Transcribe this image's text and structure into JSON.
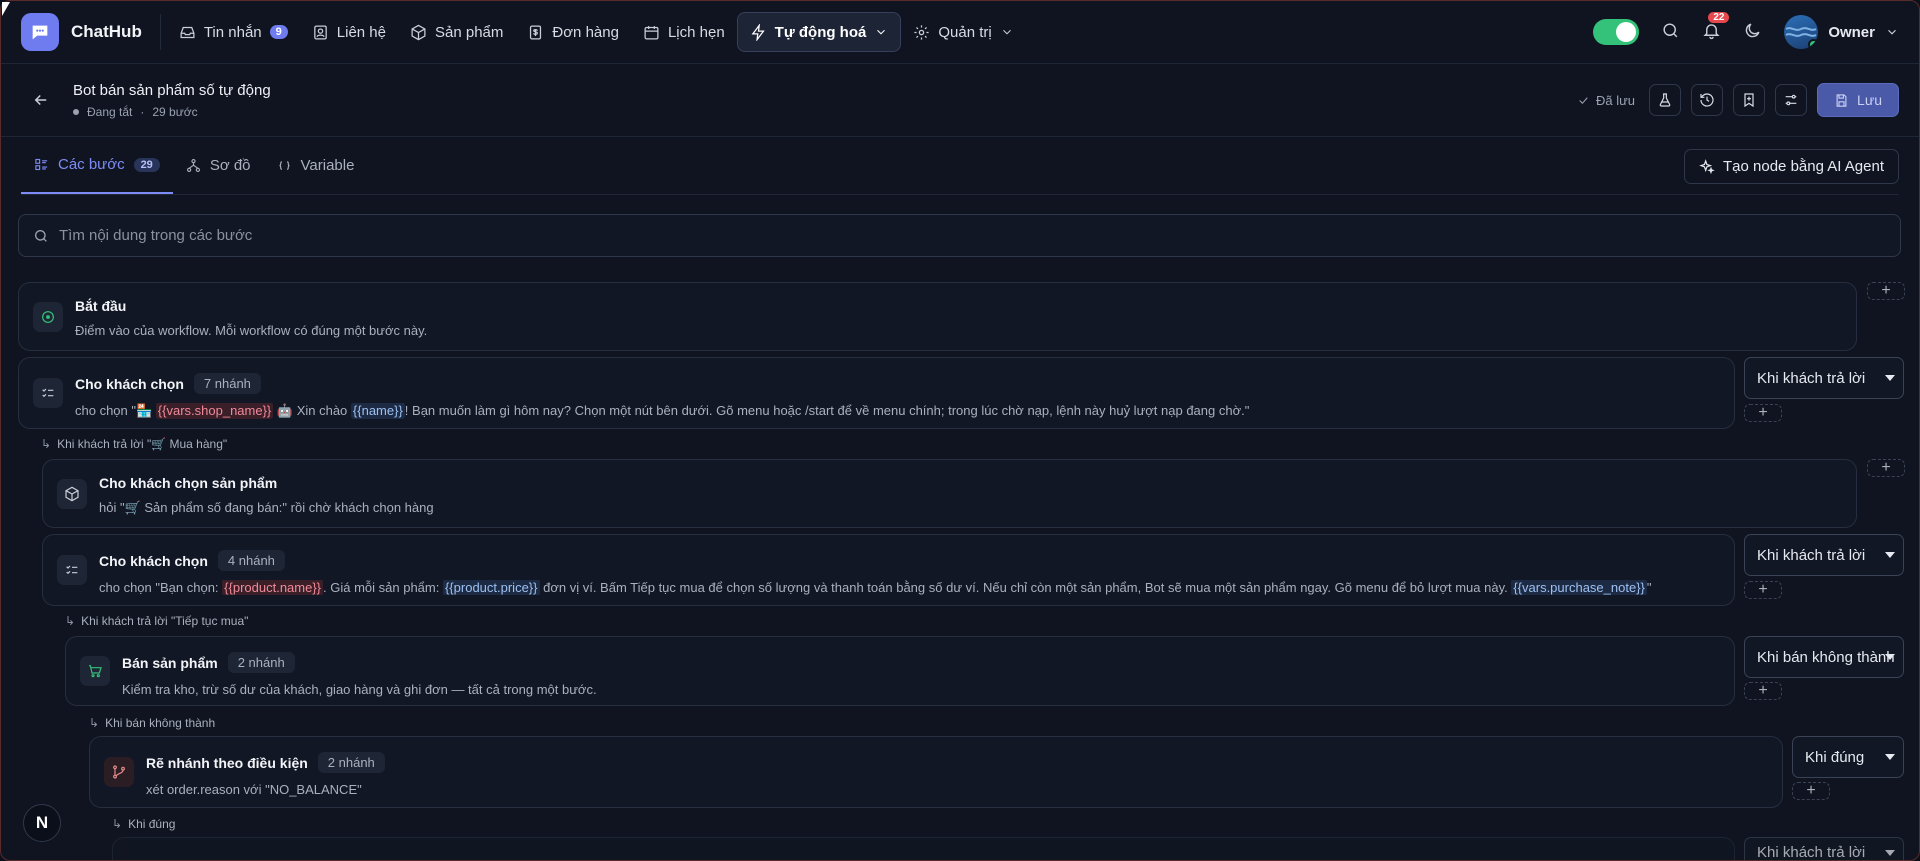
{
  "nav": {
    "brand": "ChatHub",
    "items": [
      {
        "label": "Tin nhắn",
        "badge": "9",
        "icon": "inbox-icon"
      },
      {
        "label": "Liên hệ",
        "icon": "contact-icon"
      },
      {
        "label": "Sản phẩm",
        "icon": "box-icon"
      },
      {
        "label": "Đơn hàng",
        "icon": "receipt-icon"
      },
      {
        "label": "Lịch hẹn",
        "icon": "calendar-icon"
      },
      {
        "label": "Tự động hoá",
        "icon": "bolt-icon",
        "active": true
      },
      {
        "label": "Quản trị",
        "icon": "gear-icon"
      }
    ],
    "notifications": "22",
    "user": "Owner"
  },
  "workflow": {
    "title": "Bot bán sản phẩm số tự động",
    "status": "Đang tắt",
    "steps_count": "29 bước",
    "saved": "Đã lưu",
    "save_label": "Lưu"
  },
  "tabs": [
    {
      "label": "Các bước",
      "count": "29",
      "active": true
    },
    {
      "label": "Sơ đồ"
    },
    {
      "label": "Variable"
    }
  ],
  "ai_button": "Tạo node bằng AI Agent",
  "search": {
    "placeholder": "Tìm nội dung trong các bước"
  },
  "steps": {
    "s1": {
      "title": "Bắt đầu",
      "desc": "Điểm vào của workflow. Mỗi workflow có đúng một bước này."
    },
    "s2": {
      "title": "Cho khách chọn",
      "pill": "7 nhánh",
      "desc_a": "cho chọn \"🏪 ",
      "var1": "{{vars.shop_name}}",
      "desc_b": " 🤖 Xin chào ",
      "var2": "{{name}}",
      "desc_c": "! Bạn muốn làm gì hôm nay? Chọn một nút bên dưới. Gõ menu hoặc /start để về menu chính; trong lúc chờ nạp, lệnh này huỷ lượt nạp đang chờ.\"",
      "branch": "Khi khách trả lời"
    },
    "b2": "Khi khách trả lời \"🛒 Mua hàng\"",
    "s3": {
      "title": "Cho khách chọn sản phẩm",
      "desc": "hỏi \"🛒 Sản phẩm số đang bán:\" rồi chờ khách chọn hàng"
    },
    "s4": {
      "title": "Cho khách chọn",
      "pill": "4 nhánh",
      "desc_a": "cho chọn \"Bạn chọn: ",
      "var1": "{{product.name}}",
      "desc_b": ". Giá mỗi sản phẩm: ",
      "var2": "{{product.price}}",
      "desc_c": " đơn vị ví. Bấm Tiếp tục mua để chọn số lượng và thanh toán bằng số dư ví. Nếu chỉ còn một sản phẩm, Bot sẽ mua một sản phẩm ngay. Gõ menu để bỏ lượt mua này. ",
      "var3": "{{vars.purchase_note}}",
      "desc_d": "\"",
      "branch": "Khi khách trả lời"
    },
    "b4": "Khi khách trả lời \"Tiếp tục mua\"",
    "s5": {
      "title": "Bán sản phẩm",
      "pill": "2 nhánh",
      "desc": "Kiểm tra kho, trừ số dư của khách, giao hàng và ghi đơn — tất cả trong một bước.",
      "branch": "Khi bán không thành"
    },
    "b5": "Khi bán không thành",
    "s6": {
      "title": "Rẽ nhánh theo điều kiện",
      "pill": "2 nhánh",
      "desc": "xét order.reason với \"NO_BALANCE\"",
      "branch": "Khi đúng"
    },
    "b6": "Khi đúng",
    "s7": {
      "branch": "Khi khách trả lời"
    }
  },
  "colors": {
    "accent": "#7d8cf5",
    "toggle_on": "#34c17a",
    "notif": "#e5484d"
  }
}
